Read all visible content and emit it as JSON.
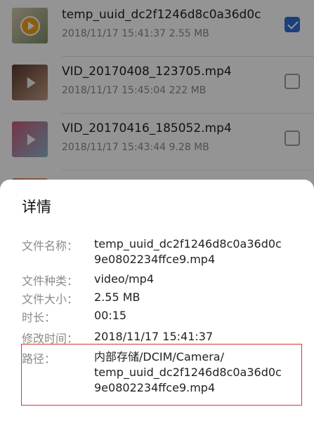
{
  "files": [
    {
      "name": "temp_uuid_dc2f1246d8c0a36d0c",
      "date": "2018/11/17 15:41:37",
      "size": "2.55 MB",
      "checked": true,
      "thumb_colors": [
        "#d8c9b0",
        "#7c8f6a"
      ],
      "thumb_icon": "play-circle-icon"
    },
    {
      "name": "VID_20170408_123705.mp4",
      "date": "2018/11/17 15:45:04",
      "size": "222 MB",
      "checked": false,
      "thumb_colors": [
        "#5a3a2e",
        "#c49a84"
      ],
      "thumb_icon": "play-icon"
    },
    {
      "name": "VID_20170416_185052.mp4",
      "date": "2018/11/17 15:43:44",
      "size": "9.28 MB",
      "checked": false,
      "thumb_colors": [
        "#c65f7e",
        "#8fb4c9"
      ],
      "thumb_icon": "play-icon"
    },
    {
      "name": "",
      "date": "",
      "size": "",
      "checked": false,
      "thumb_colors": [
        "#e07a5f",
        "#f2cc8f"
      ],
      "thumb_icon": "play-icon"
    }
  ],
  "details": {
    "title": "详情",
    "rows": [
      {
        "label": "文件名称：",
        "value_lines": [
          "temp_uuid_dc2f1246d8c0a36d0c",
          "9e0802234ffce9.mp4"
        ]
      },
      {
        "label": "文件种类：",
        "value_lines": [
          "video/mp4"
        ]
      },
      {
        "label": "文件大小：",
        "value_lines": [
          "2.55 MB"
        ]
      },
      {
        "label": "时长：",
        "value_lines": [
          "00:15"
        ]
      },
      {
        "label": "修改时间：",
        "value_lines": [
          "2018/11/17 15:41:37"
        ]
      },
      {
        "label": "路径：",
        "value_lines": [
          "内部存储/DCIM/Camera/",
          "temp_uuid_dc2f1246d8c0a36d0c",
          "9e0802234ffce9.mp4"
        ]
      }
    ]
  },
  "colors": {
    "accent": "#2f6fd6",
    "highlight": "#e0312e"
  }
}
